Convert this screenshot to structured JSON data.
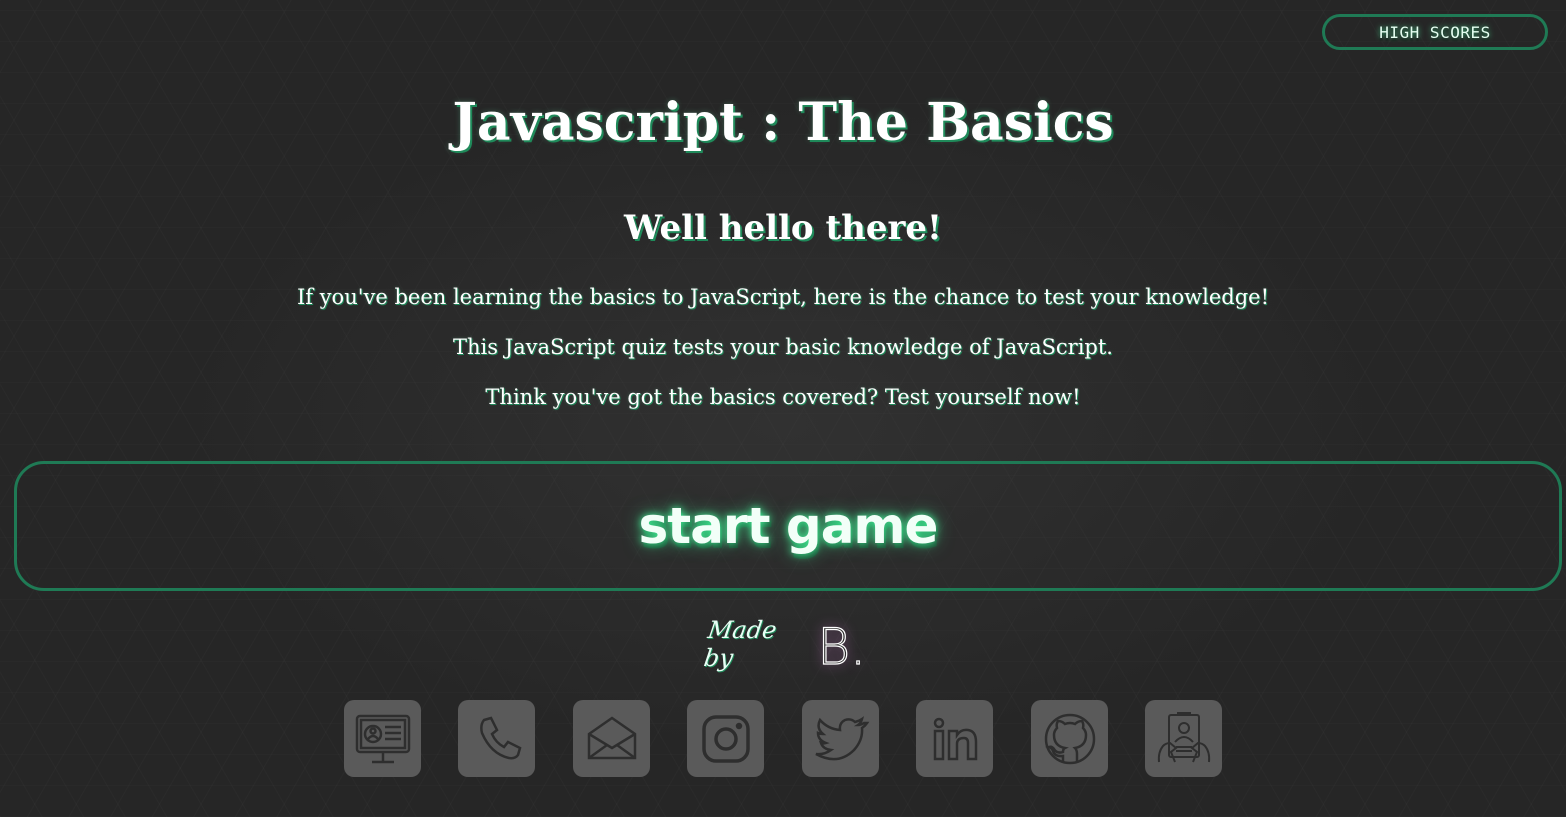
{
  "header": {
    "high_scores_label": "HIGH SCORES"
  },
  "main": {
    "title": "Javascript : The Basics",
    "subtitle": "Well hello there!",
    "paragraphs": [
      "If you've been learning the basics to JavaScript, here is the chance to test your knowledge!",
      "This JavaScript quiz tests your basic knowledge of JavaScript.",
      "Think you've got the basics covered? Test yourself now!"
    ],
    "start_label": "start game"
  },
  "footer": {
    "made_by_text": "Made by",
    "made_by_logo": "B.",
    "social_icons": [
      "portfolio-icon",
      "phone-icon",
      "email-icon",
      "instagram-icon",
      "twitter-icon",
      "linkedin-icon",
      "github-icon",
      "resume-icon"
    ]
  },
  "colors": {
    "background": "#262626",
    "accent_green": "#1f7a55",
    "glow_green": "#46ffa0",
    "icon_tile": "#5a5a5a",
    "icon_stroke": "#2e2e2e"
  }
}
